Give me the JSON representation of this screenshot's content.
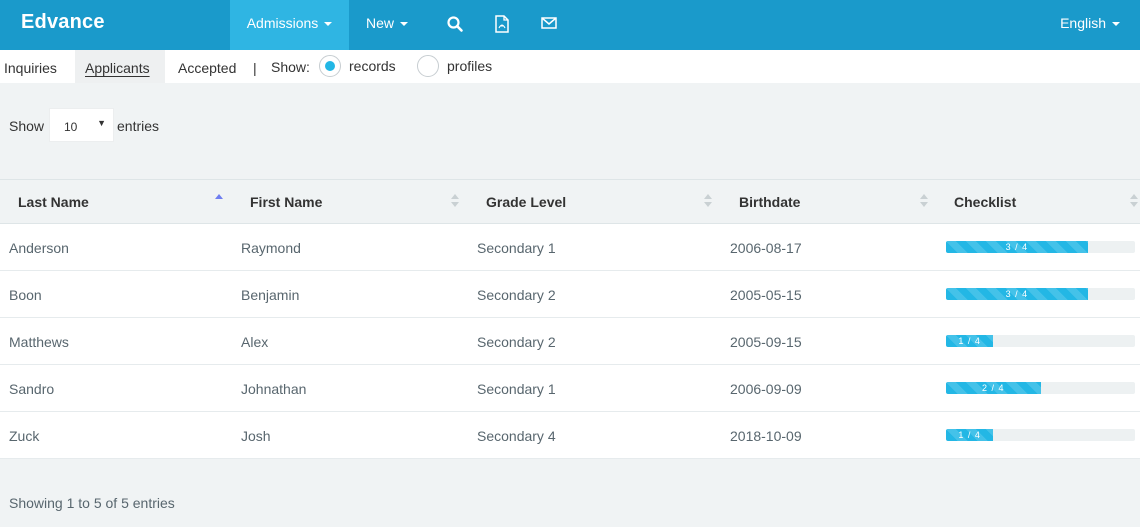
{
  "nav": {
    "brand": "Edvance",
    "admissions": "Admissions",
    "new": "New",
    "language": "English",
    "icons": [
      "search-icon",
      "pdf-icon",
      "mail-icon"
    ]
  },
  "subnav": {
    "inquiries": "Inquiries",
    "applicants": "Applicants",
    "accepted": "Accepted",
    "separator": "|",
    "show": "Show:",
    "records": "records",
    "profiles": "profiles",
    "selected": "records"
  },
  "length": {
    "show": "Show",
    "value": "10",
    "entries": "entries"
  },
  "table": {
    "columns": [
      "Last Name",
      "First Name",
      "Grade Level",
      "Birthdate",
      "Checklist"
    ],
    "sorted_column": "Last Name",
    "rows": [
      {
        "last": "Anderson",
        "first": "Raymond",
        "grade": "Secondary 1",
        "birthdate": "2006-08-17",
        "checklist": "3 / 4",
        "progress": 0.75
      },
      {
        "last": "Boon",
        "first": "Benjamin",
        "grade": "Secondary 2",
        "birthdate": "2005-05-15",
        "checklist": "3 / 4",
        "progress": 0.75
      },
      {
        "last": "Matthews",
        "first": "Alex",
        "grade": "Secondary 2",
        "birthdate": "2005-09-15",
        "checklist": "1 / 4",
        "progress": 0.25
      },
      {
        "last": "Sandro",
        "first": "Johnathan",
        "grade": "Secondary 1",
        "birthdate": "2006-09-09",
        "checklist": "2 / 4",
        "progress": 0.5
      },
      {
        "last": "Zuck",
        "first": "Josh",
        "grade": "Secondary 4",
        "birthdate": "2018-10-09",
        "checklist": "1 / 4",
        "progress": 0.25
      }
    ]
  },
  "info": "Showing 1 to 5 of 5 entries",
  "colors": {
    "nav_bg": "#1a9acb",
    "nav_active": "#2fb5e3",
    "progress": "#23b7e5"
  }
}
